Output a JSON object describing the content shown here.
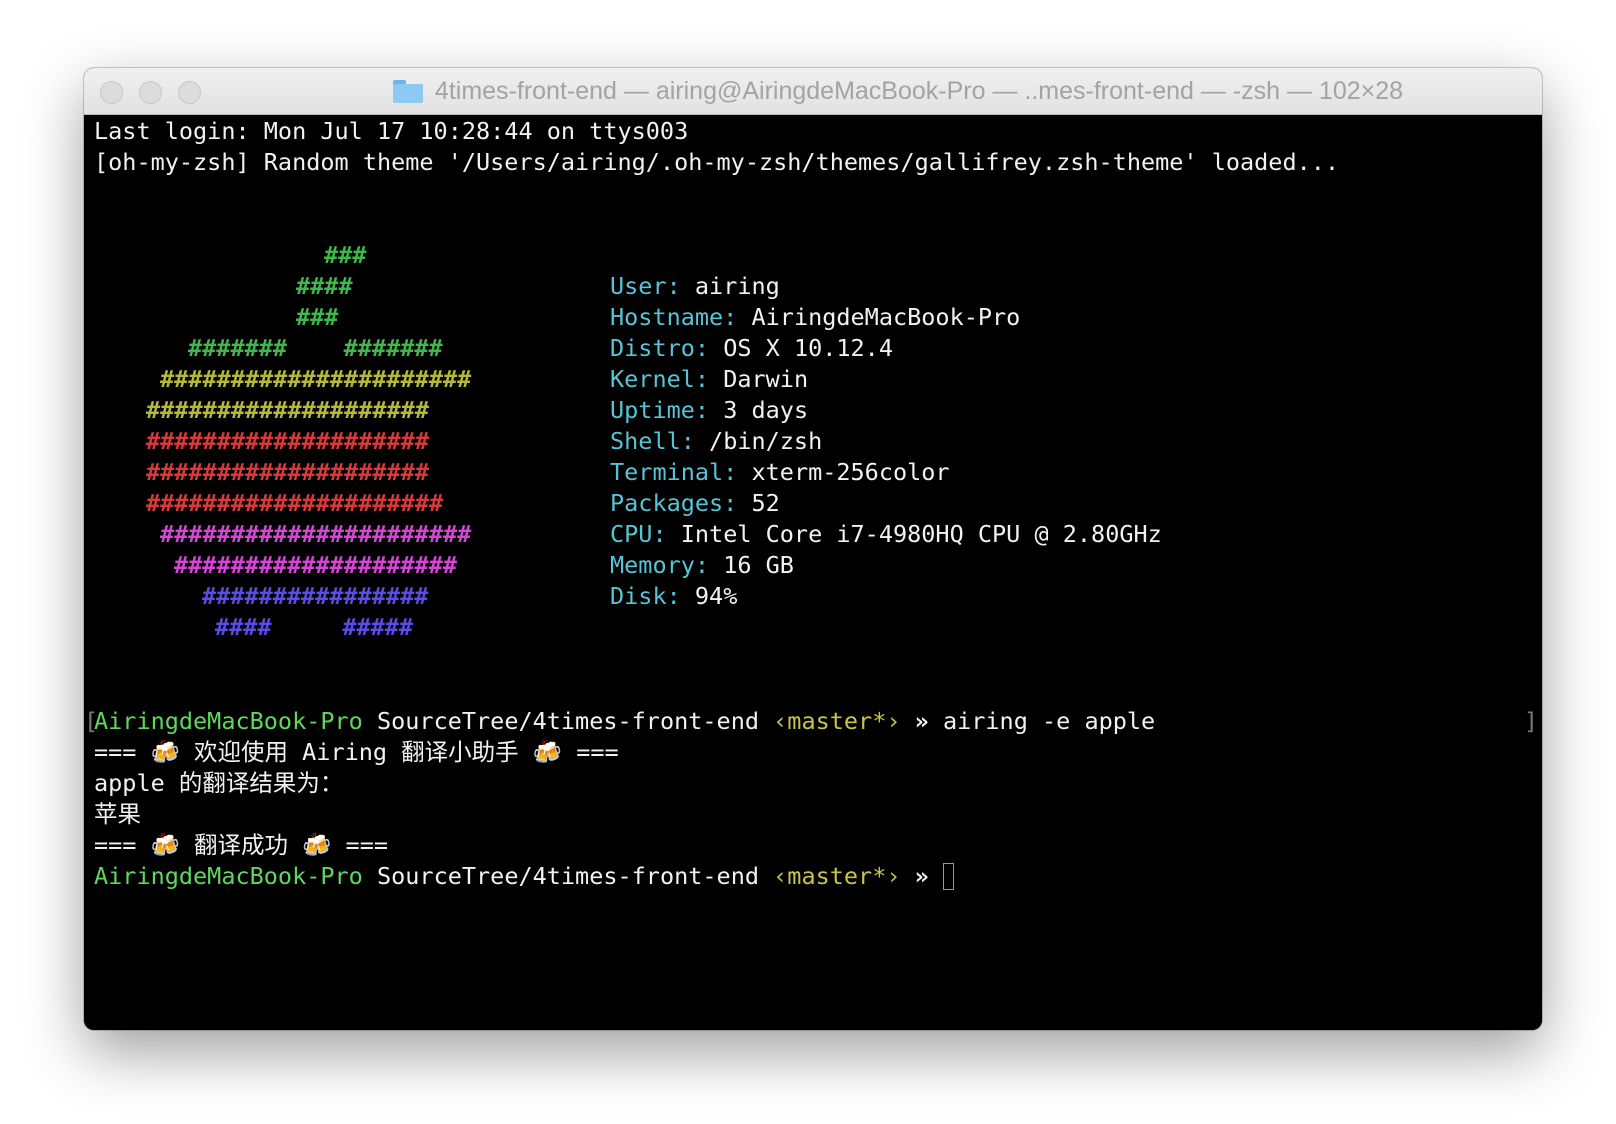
{
  "window": {
    "title": "4times-front-end — airing@AiringdeMacBook-Pro — ..mes-front-end — -zsh — 102×28",
    "folder_icon": "folder-icon"
  },
  "terminal": {
    "login_line": "Last login: Mon Jul 17 10:28:44 on ttys003",
    "theme_line": "[oh-my-zsh] Random theme '/Users/airing/.oh-my-zsh/themes/gallifrey.zsh-theme' loaded...",
    "logo_rows": [
      {
        "text": "###",
        "color": "#3fb74a"
      },
      {
        "text": "####",
        "color": "#3fb74a"
      },
      {
        "text": "###",
        "color": "#3fb74a"
      },
      {
        "text": "#######    #######",
        "color": "#3fb74a"
      },
      {
        "text": "######################",
        "color": "#b5b83a"
      },
      {
        "text": "####################",
        "color": "#b5b83a"
      },
      {
        "text": "####################",
        "color": "#d73a3a"
      },
      {
        "text": "####################",
        "color": "#d73a3a"
      },
      {
        "text": "#####################",
        "color": "#d73a3a"
      },
      {
        "text": "######################",
        "color": "#d646d6"
      },
      {
        "text": "####################",
        "color": "#d646d6"
      },
      {
        "text": "################",
        "color": "#5a4de6"
      },
      {
        "text": "####     #####",
        "color": "#5a4de6"
      }
    ],
    "sysinfo": [
      {
        "label": "User:",
        "value": "airing"
      },
      {
        "label": "Hostname:",
        "value": "AiringdeMacBook-Pro"
      },
      {
        "label": "Distro:",
        "value": "OS X 10.12.4"
      },
      {
        "label": "Kernel:",
        "value": "Darwin"
      },
      {
        "label": "Uptime:",
        "value": "3 days"
      },
      {
        "label": "Shell:",
        "value": "/bin/zsh"
      },
      {
        "label": "Terminal:",
        "value": "xterm-256color"
      },
      {
        "label": "Packages:",
        "value": "52"
      },
      {
        "label": "CPU:",
        "value": "Intel Core i7-4980HQ CPU @ 2.80GHz"
      },
      {
        "label": "Memory:",
        "value": "16 GB"
      },
      {
        "label": "Disk:",
        "value": "94%"
      }
    ],
    "prompt": {
      "bracket_open": "[",
      "bracket_close": "]",
      "host": "AiringdeMacBook-Pro",
      "path": "SourceTree/4times-front-end",
      "branch": "‹master*›",
      "arrow": "»",
      "command": "airing -e apple"
    },
    "output": {
      "welcome": "=== 🍻 欢迎使用 Airing 翻译小助手 🍻 ===",
      "result_intro": "apple 的翻译结果为：",
      "result": "苹果",
      "success": "=== 🍻 翻译成功 🍻 ==="
    },
    "colors": {
      "label": "#58c3d6",
      "host": "#5fd75f",
      "branch": "#c8c44a",
      "text": "#f2f2f2"
    }
  }
}
